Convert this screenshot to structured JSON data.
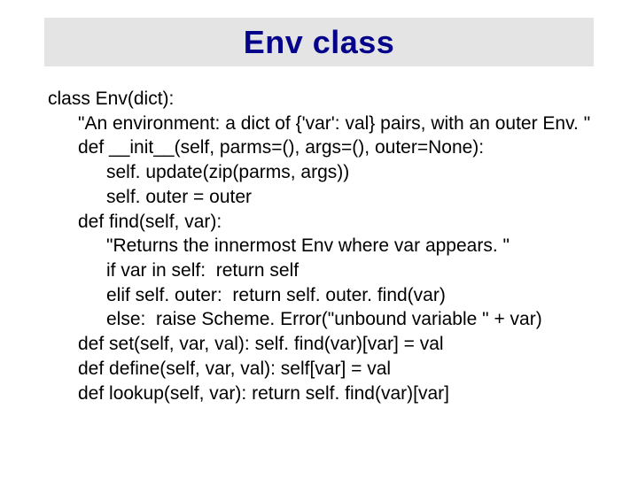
{
  "slide": {
    "title": "Env class"
  },
  "code": {
    "l0": "class Env(dict):",
    "l1": "\"An environment: a dict of {'var': val} pairs, with an outer Env. \"",
    "l2": "def __init__(self, parms=(), args=(), outer=None):",
    "l3": "self. update(zip(parms, args))",
    "l4": "self. outer = outer",
    "l5": "def find(self, var):",
    "l6": "\"Returns the innermost Env where var appears. \"",
    "l7": "if var in self:  return self",
    "l8": "elif self. outer:  return self. outer. find(var)",
    "l9": "else:  raise Scheme. Error(\"unbound variable \" + var)",
    "l10": "def set(self, var, val): self. find(var)[var] = val",
    "l11": "def define(self, var, val): self[var] = val",
    "l12": "def lookup(self, var): return self. find(var)[var]"
  }
}
